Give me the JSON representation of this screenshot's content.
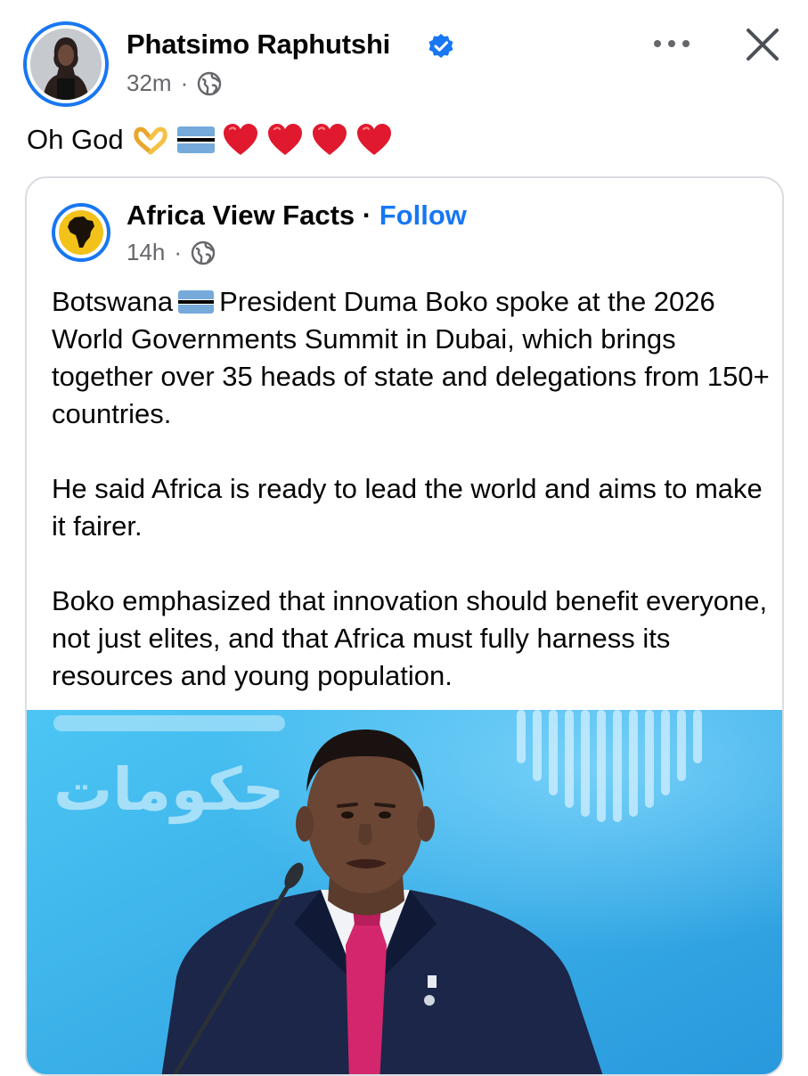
{
  "post": {
    "author": "Phatsimo Raphutshi",
    "time": "32m",
    "text": "Oh God",
    "icons": {
      "verified": "verified-badge-icon",
      "audience": "globe-icon",
      "more": "more-options-icon",
      "close": "close-icon"
    },
    "emojis": [
      "heart-hands-icon",
      "botswana-flag-icon",
      "red-heart-icon",
      "red-heart-icon",
      "red-heart-icon",
      "red-heart-icon"
    ]
  },
  "shared": {
    "page_name": "Africa View Facts",
    "separator": "·",
    "follow_label": "Follow",
    "time": "14h",
    "body": {
      "p1_before_flag": "Botswana",
      "p1_after_flag": "President Duma Boko spoke at the 2026 World Governments Summit in Dubai, which brings together over 35 heads of state and delegations from 150+ countries.",
      "p2": "He said Africa is ready to lead the world and aims to make it fairer.",
      "p3": "Boko emphasized that innovation should benefit everyone, not just elites, and that Africa must fully harness its resources and young population."
    },
    "image": {
      "backdrop_text": "حكومات"
    }
  },
  "colors": {
    "accent": "#1877f2",
    "meta_text": "#65676b",
    "heart": "#e0192f",
    "flag_blue": "#75aadb",
    "media_blue": "#2ea8e8"
  }
}
